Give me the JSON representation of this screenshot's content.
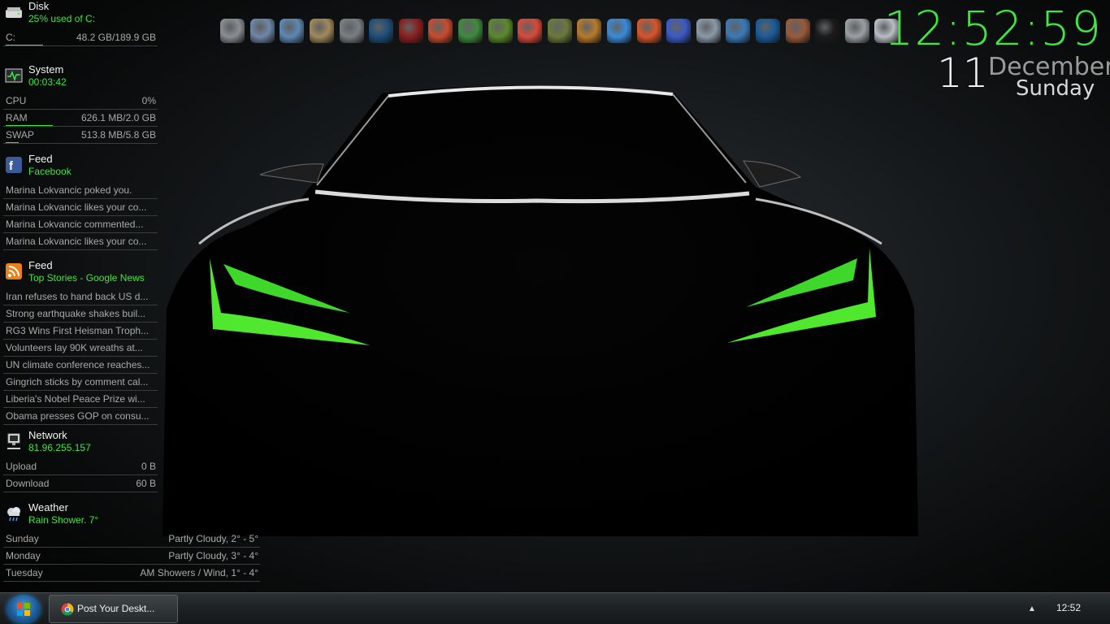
{
  "disk": {
    "title": "Disk",
    "subtitle": "25% used of C:",
    "drive_label": "C:",
    "drive_value": "48.2 GB/189.9 GB",
    "used_fraction": 0.25
  },
  "system": {
    "title": "System",
    "uptime": "00:03:42",
    "rows": [
      {
        "label": "CPU",
        "value": "0%",
        "fraction": 0.0
      },
      {
        "label": "RAM",
        "value": "626.1 MB/2.0 GB",
        "fraction": 0.31
      },
      {
        "label": "SWAP",
        "value": "513.8 MB/5.8 GB",
        "fraction": 0.09
      }
    ]
  },
  "facebook_feed": {
    "title": "Feed",
    "subtitle": "Facebook",
    "items": [
      "Marina Lokvancic poked you.",
      "Marina Lokvancic likes your co...",
      "Marina Lokvancic commented...",
      "Marina Lokvancic likes your co..."
    ]
  },
  "news_feed": {
    "title": "Feed",
    "subtitle": "Top Stories - Google News",
    "items": [
      "Iran refuses to hand back US d...",
      "Strong earthquake shakes buil...",
      "RG3 Wins First Heisman Troph...",
      "Volunteers lay 90K wreaths at...",
      "UN climate conference reaches...",
      "Gingrich sticks by comment cal...",
      "Liberia's Nobel Peace Prize wi...",
      "Obama presses GOP on consu..."
    ]
  },
  "network": {
    "title": "Network",
    "ip": "81.96.255.157",
    "rows": [
      {
        "label": "Upload",
        "value": "0 B"
      },
      {
        "label": "Download",
        "value": "60 B"
      }
    ]
  },
  "weather": {
    "title": "Weather",
    "current": "Rain Shower. 7°",
    "forecast": [
      {
        "day": "Sunday",
        "value": "Partly Cloudy, 2° - 5°"
      },
      {
        "day": "Monday",
        "value": "Partly Cloudy, 3° - 4°"
      },
      {
        "day": "Tuesday",
        "value": "AM Showers / Wind, 1° - 4°"
      }
    ]
  },
  "dock": {
    "icons": [
      {
        "name": "computer-icon",
        "color": "#8a8f95"
      },
      {
        "name": "network-drive-icon",
        "color": "#6f87a8"
      },
      {
        "name": "documents-icon",
        "color": "#5d88b5"
      },
      {
        "name": "music-icon",
        "color": "#a08a5a"
      },
      {
        "name": "library-icon",
        "color": "#7a7f84"
      },
      {
        "name": "gear-icon",
        "color": "#1d4f7a"
      },
      {
        "name": "2se-icon",
        "color": "#8b1f1f"
      },
      {
        "name": "cube-icon",
        "color": "#c94b2e"
      },
      {
        "name": "number-two-icon",
        "color": "#3d8a3d"
      },
      {
        "name": "eye-icon",
        "color": "#5a8a2a"
      },
      {
        "name": "chrome-icon",
        "color": "#d94a3a"
      },
      {
        "name": "eye-icon",
        "color": "#6a7a3a"
      },
      {
        "name": "number-two-icon",
        "color": "#b87a2a"
      },
      {
        "name": "messenger-icon",
        "color": "#3a8ad8"
      },
      {
        "name": "paint-icon",
        "color": "#d8552a"
      },
      {
        "name": "registry-icon",
        "color": "#3a5ac8"
      },
      {
        "name": "chart-icon",
        "color": "#8a9aa8"
      },
      {
        "name": "windows-update-icon",
        "color": "#3a7ab8"
      },
      {
        "name": "home-network-icon",
        "color": "#1a5a9a"
      },
      {
        "name": "palette-icon",
        "color": "#9a5a3a"
      },
      {
        "name": "video-icon",
        "color": "#1a1a1a"
      },
      {
        "name": "tools-icon",
        "color": "#9aa0a6"
      },
      {
        "name": "recycle-bin-icon",
        "color": "#b8bec4"
      }
    ]
  },
  "clock": {
    "time": "12:52:59",
    "day": "11",
    "month": "December",
    "weekday": "Sunday",
    "accent": "#3fe83f"
  },
  "taskbar": {
    "task_label": "Post Your Deskt...",
    "tray_arrow": "▲",
    "tray_time": "12:52"
  }
}
